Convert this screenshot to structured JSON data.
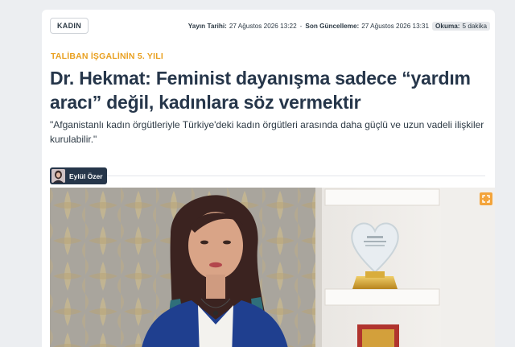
{
  "article": {
    "category": "KADIN",
    "meta": {
      "published_label": "Yayın Tarihi:",
      "published_value": "27 Ağustos 2026 13:22",
      "separator": "-",
      "updated_label": "Son Güncelleme:",
      "updated_value": "27 Ağustos 2026 13:31",
      "read_label": "Okuma:",
      "read_value": "5 dakika"
    },
    "kicker": "TALİBAN İŞGALİNİN 5. YILI",
    "headline": "Dr. Hekmat: Feminist dayanışma sadece “yardım aracı” değil, kadınlara söz vermektir",
    "spot": "\"Afganistanlı kadın örgütleriyle Türkiye'deki kadın örgütleri arasında daha güçlü ve uzun vadeli ilişkiler kurulabilir.\"",
    "author": {
      "name": "Eylül Özer"
    },
    "image": {
      "expand_icon": "expand-icon"
    }
  },
  "colors": {
    "kicker": "#e9a020",
    "headline": "#26364a",
    "author_bg": "#26364a",
    "expand_btn": "#f3a43b",
    "page_bg": "#eceef1"
  }
}
